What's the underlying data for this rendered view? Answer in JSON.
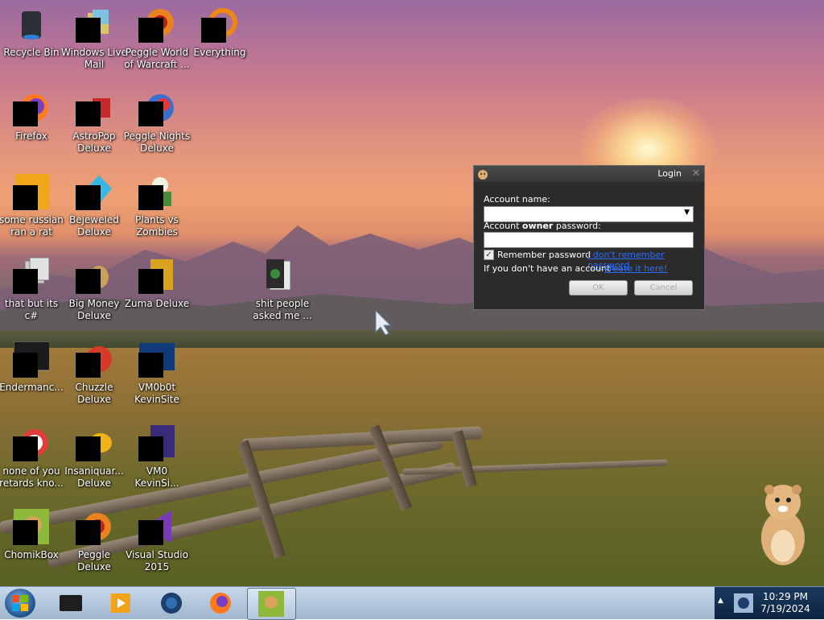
{
  "desktop": {
    "icons": [
      {
        "label": "Recycle Bin",
        "icon": "recycle-bin-icon"
      },
      {
        "label": "Windows Live Mail",
        "icon": "mail-icon"
      },
      {
        "label": "Peggle World of Warcraft ...",
        "icon": "peggle-icon"
      },
      {
        "label": "Everything",
        "icon": "search-icon"
      },
      {
        "label": "Firefox",
        "icon": "firefox-icon"
      },
      {
        "label": "AstroPop Deluxe",
        "icon": "game-icon"
      },
      {
        "label": "Peggle Nights Deluxe",
        "icon": "peggle-icon"
      },
      {
        "label": "some russian ran a rat",
        "icon": "file-icon"
      },
      {
        "label": "Bejeweled Deluxe",
        "icon": "gem-icon"
      },
      {
        "label": "Plants vs Zombies",
        "icon": "plant-icon"
      },
      {
        "label": "that but its c#",
        "icon": "file-icon"
      },
      {
        "label": "Big Money Deluxe",
        "icon": "money-icon"
      },
      {
        "label": "Zuma Deluxe",
        "icon": "zuma-icon"
      },
      {
        "label": "shit people asked me ...",
        "icon": "folder-icon"
      },
      {
        "label": "Endermanc...",
        "icon": "app-icon"
      },
      {
        "label": "Chuzzle Deluxe",
        "icon": "chuzzle-icon"
      },
      {
        "label": "VM0b0t KevinSite",
        "icon": "app-icon"
      },
      {
        "label": "none of you retards kno...",
        "icon": "app-icon"
      },
      {
        "label": "Insaniquar... Deluxe",
        "icon": "fish-icon"
      },
      {
        "label": "VM0 KevinSi...",
        "icon": "app-icon"
      },
      {
        "label": "ChomikBox",
        "icon": "chomikbox-icon"
      },
      {
        "label": "Peggle Deluxe",
        "icon": "peggle-icon"
      },
      {
        "label": "Visual Studio 2015",
        "icon": "visual-studio-icon"
      }
    ]
  },
  "dialog": {
    "title": "Login",
    "close": "✕",
    "account_name_label": "Account name:",
    "password_label_prefix": "Account ",
    "password_label_bold": "owner",
    "password_label_suffix": " password:",
    "remember_label": "Remember password",
    "remember_checked": true,
    "forgot_link": "I don't remember password",
    "no_account_text": "If you don't have an account -",
    "create_link": "create it here!",
    "ok_label": "OK",
    "cancel_label": "Cancel"
  },
  "taskbar": {
    "items": [
      "terminal-icon",
      "media-player-icon",
      "globe-icon",
      "firefox-icon",
      "chomikbox-icon"
    ],
    "tray_arrow": "▲",
    "time": "10:29 PM",
    "date": "7/19/2024"
  },
  "colors": {
    "accent": "#2d6cff",
    "dialog_bg": "#2b2b2b",
    "taskbar": "#b5c9de"
  }
}
